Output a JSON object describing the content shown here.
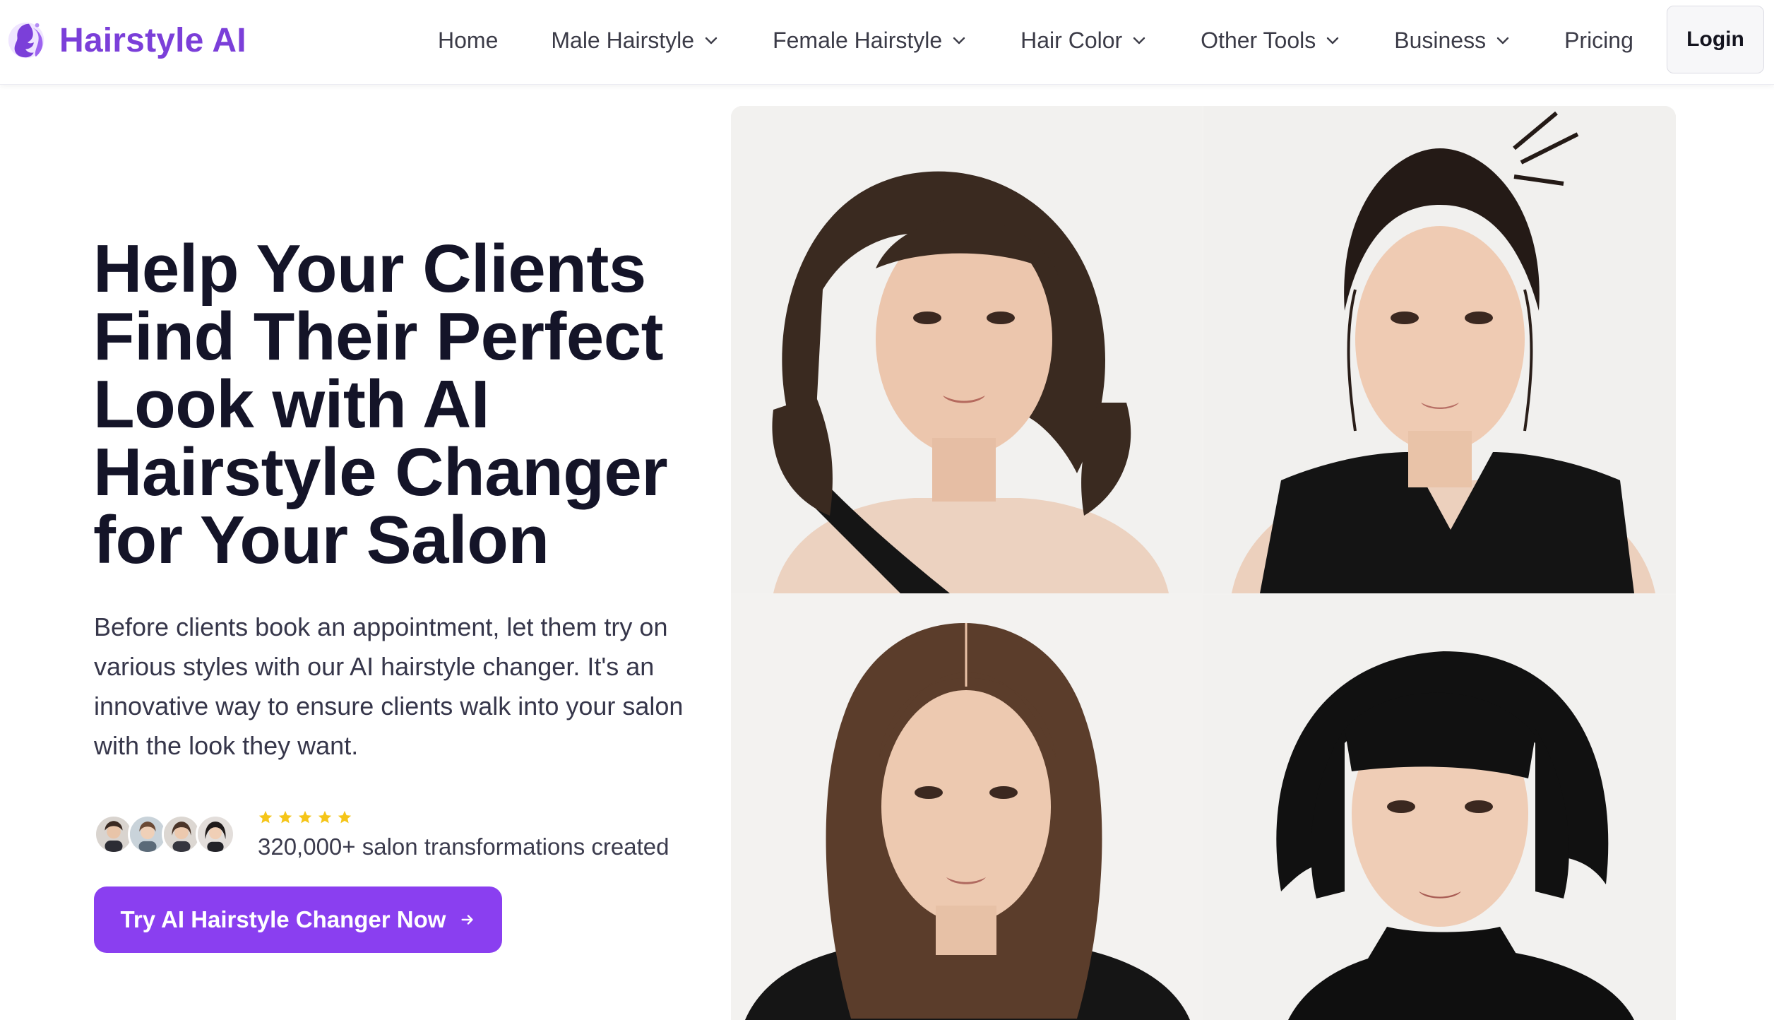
{
  "brand": {
    "name": "Hairstyle AI",
    "logo_icon": "woman-silhouette-logo-icon",
    "color": "#7b3fd9"
  },
  "nav": {
    "items": [
      {
        "label": "Home",
        "dropdown": false
      },
      {
        "label": "Male Hairstyle",
        "dropdown": true
      },
      {
        "label": "Female Hairstyle",
        "dropdown": true
      },
      {
        "label": "Hair Color",
        "dropdown": true
      },
      {
        "label": "Other Tools",
        "dropdown": true
      },
      {
        "label": "Business",
        "dropdown": true
      },
      {
        "label": "Pricing",
        "dropdown": false
      }
    ],
    "login_label": "Login"
  },
  "hero": {
    "title": "Help Your Clients Find Their Perfect Look with AI Hairstyle Changer for Your Salon",
    "description": "Before clients book an appointment, let them try on various styles with our AI hairstyle changer. It's an innovative way to ensure clients walk into your salon with the look they want.",
    "rating_stars": 5,
    "social_proof": "320,000+ salon transformations created",
    "cta_label": "Try AI Hairstyle Changer Now",
    "cta_color": "#8a3ff0"
  },
  "gallery": {
    "images": [
      {
        "name": "wavy-brown-shoulder-length-hairstyle"
      },
      {
        "name": "dark-updo-with-face-framing-strands-hairstyle"
      },
      {
        "name": "sleek-straight-middle-part-hairstyle"
      },
      {
        "name": "black-bob-with-bangs-hairstyle"
      }
    ]
  },
  "colors": {
    "star": "#f5c518",
    "text_dark": "#141428"
  }
}
